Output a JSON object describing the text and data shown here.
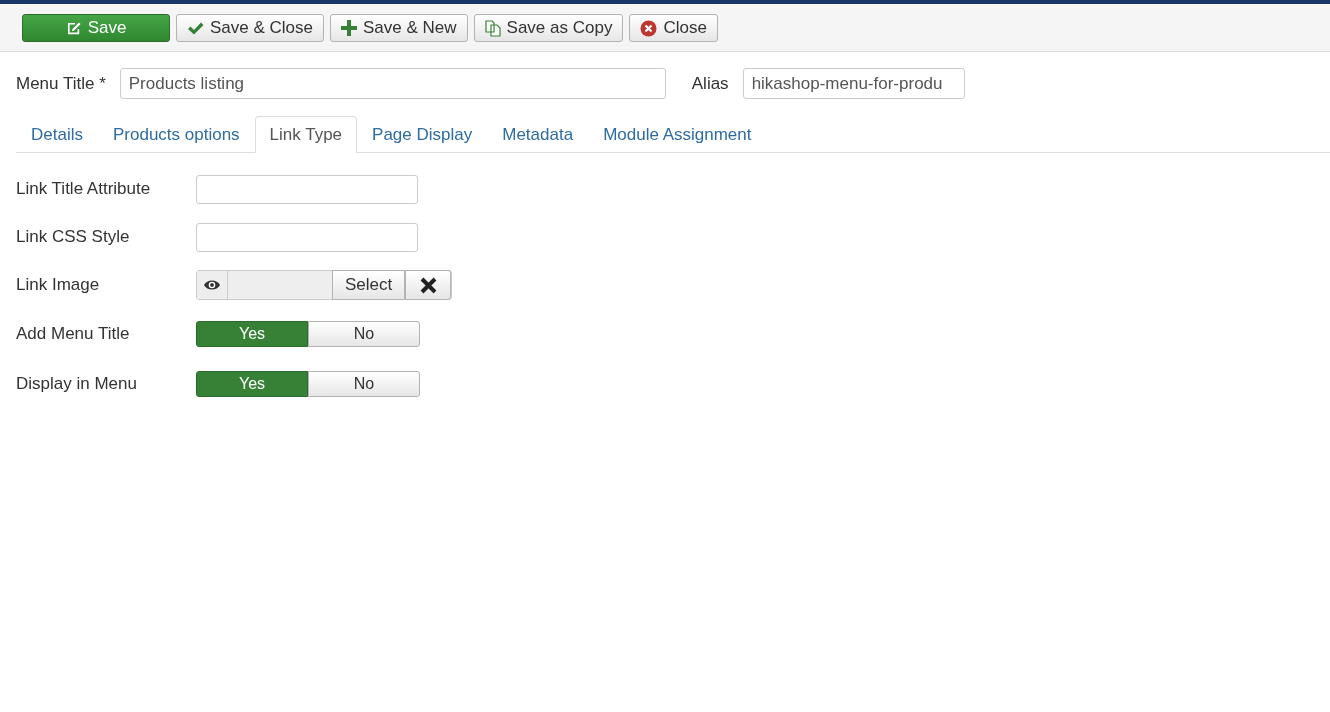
{
  "toolbar": [
    {
      "label": "Save",
      "kind": "edit",
      "primary": true
    },
    {
      "label": "Save & Close",
      "kind": "check",
      "primary": false
    },
    {
      "label": "Save & New",
      "kind": "plus",
      "primary": false
    },
    {
      "label": "Save as Copy",
      "kind": "copy",
      "primary": false
    },
    {
      "label": "Close",
      "kind": "close",
      "primary": false
    }
  ],
  "title_field": {
    "label": "Menu Title *",
    "value": "Products listing"
  },
  "alias_field": {
    "label": "Alias",
    "value": "hikashop-menu-for-produ"
  },
  "tabs": [
    {
      "label": "Details",
      "selected": false
    },
    {
      "label": "Products options",
      "selected": false
    },
    {
      "label": "Link Type",
      "selected": true
    },
    {
      "label": "Page Display",
      "selected": false
    },
    {
      "label": "Metadata",
      "selected": false
    },
    {
      "label": "Module Assignment",
      "selected": false
    }
  ],
  "fields": [
    {
      "kind": "text",
      "label": "Link Title Attribute"
    },
    {
      "kind": "text",
      "label": "Link CSS Style"
    },
    {
      "kind": "media",
      "label": "Link Image",
      "select_label": "Select"
    },
    {
      "kind": "toggle",
      "label": "Add Menu Title",
      "options": [
        {
          "label": "Yes",
          "selected": true
        },
        {
          "label": "No",
          "selected": false
        }
      ]
    },
    {
      "kind": "toggle",
      "label": "Display in Menu",
      "options": [
        {
          "label": "Yes",
          "selected": true
        },
        {
          "label": "No",
          "selected": false
        }
      ]
    }
  ]
}
